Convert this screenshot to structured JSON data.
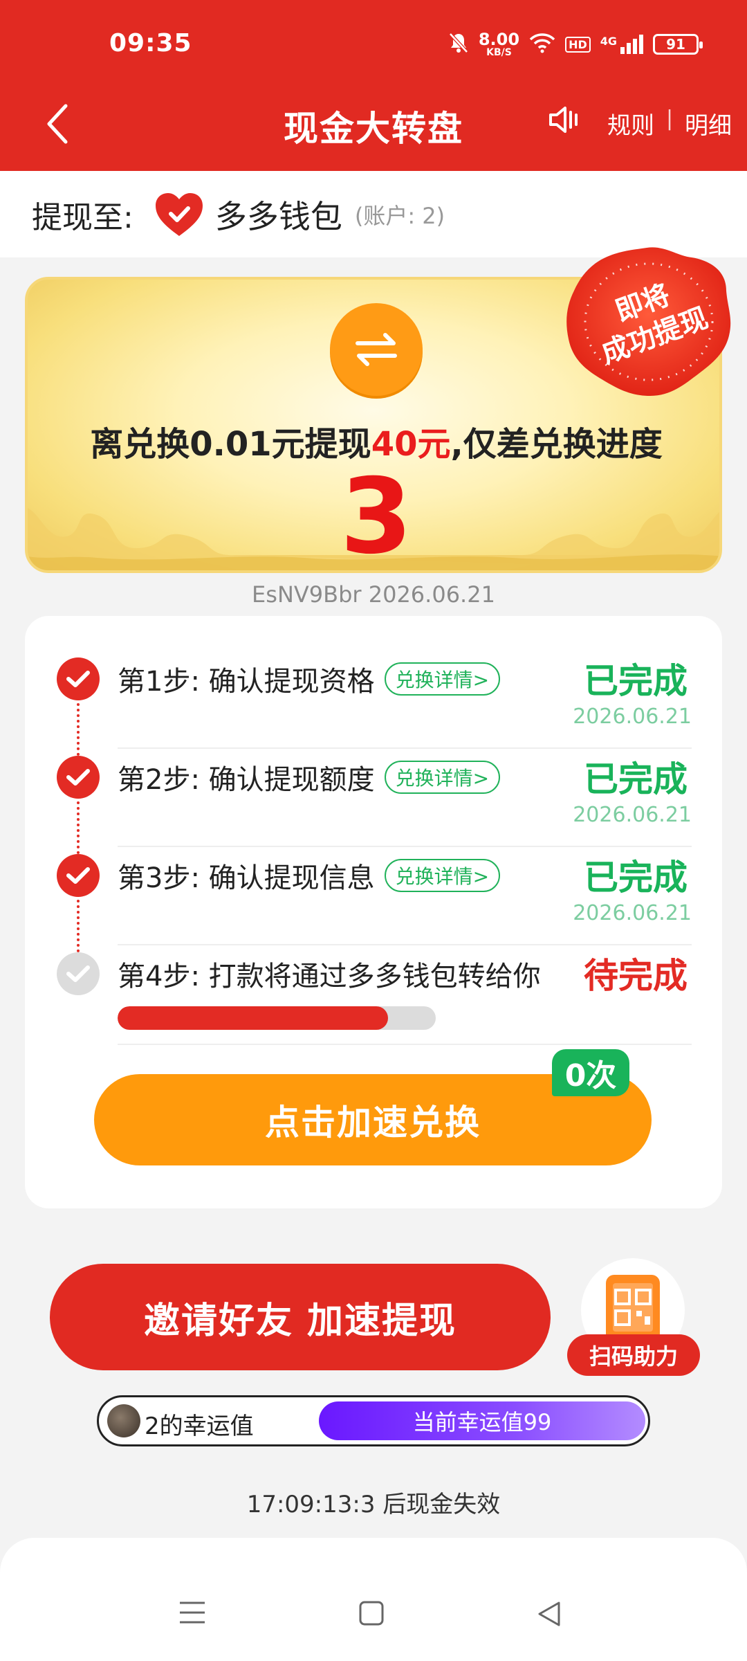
{
  "status_bar": {
    "time": "09:35",
    "speed_value": "8.00",
    "speed_unit": "KB/S",
    "hd": "HD",
    "network": "4G",
    "battery": "91"
  },
  "header": {
    "title": "现金大转盘",
    "rules": "规则",
    "separator": "|",
    "details": "明细"
  },
  "withdraw": {
    "label": "提现至:",
    "wallet": "多多钱包",
    "account": "(账户: 2)"
  },
  "card": {
    "text_prefix": "离兑换0.01元提现",
    "amount": "40元",
    "text_suffix": ",仅差兑换进度",
    "gap": "3",
    "badge_line1": "即将",
    "badge_line2": "成功提现"
  },
  "code_line": "EsNV9Bbr 2026.06.21",
  "steps": [
    {
      "text": "第1步: 确认提现资格",
      "tag": "兑换详情>",
      "status": "已完成",
      "date": "2026.06.21"
    },
    {
      "text": "第2步: 确认提现额度",
      "tag": "兑换详情>",
      "status": "已完成",
      "date": "2026.06.21"
    },
    {
      "text": "第3步: 确认提现信息",
      "tag": "兑换详情>",
      "status": "已完成",
      "date": "2026.06.21"
    },
    {
      "text": "第4步: 打款将通过多多钱包转给你",
      "status": "待完成",
      "progress": 0.85
    }
  ],
  "speed_button": {
    "label": "点击加速兑换",
    "count": "0次"
  },
  "invite": {
    "label": "邀请好友 加速提现",
    "scan_label": "扫码助力"
  },
  "luck": {
    "name": "2的幸运值",
    "value_label": "当前幸运值99"
  },
  "expire_text": "17:09:13:3 后现金失效",
  "colors": {
    "primary_red": "#e12a22",
    "orange": "#ff9a0c",
    "green": "#19b35a",
    "purple": "#6a18ff"
  }
}
